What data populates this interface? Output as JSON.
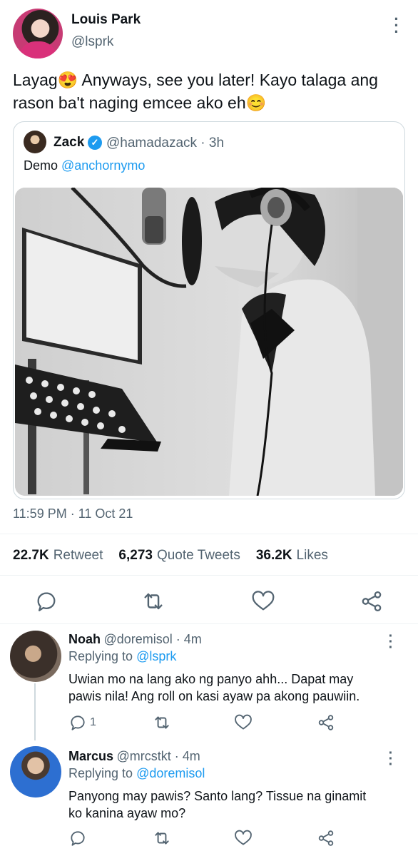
{
  "main_tweet": {
    "author_name": "Louis Park",
    "author_handle": "@lsprk",
    "text_line1": "Layag😍 Anyways, see you later! Kayo talaga ang",
    "text_line2": "rason ba't naging emcee ako eh😊",
    "more_icon": "more-icon"
  },
  "quote": {
    "author_name": "Zack",
    "verified_icon": "verified-badge-icon",
    "handle_time": "@hamadazack · 3h",
    "text_prefix": "Demo ",
    "mention": "@anchornymo",
    "image": "photo-singer-recording-booth"
  },
  "timestamp": "11:59 PM · 11 Oct 21",
  "stats": {
    "retweets_count": "22.7K",
    "retweets_label": "Retweet",
    "quotes_count": "6,273",
    "quotes_label": "Quote Tweets",
    "likes_count": "36.2K",
    "likes_label": "Likes"
  },
  "actions": [
    "reply-icon",
    "retweet-icon",
    "like-icon",
    "share-icon"
  ],
  "replies": [
    {
      "author_name": "Noah",
      "handle_time": "@doremisol · 4m",
      "replying_prefix": "Replying to ",
      "replying_to": "@lsprk",
      "text_line1": "Uwian mo na lang ako ng panyo ahh... Dapat may",
      "text_line2": "pawis nila! Ang roll on kasi ayaw pa akong pauwiin.",
      "reply_count": "1"
    },
    {
      "author_name": "Marcus",
      "handle_time": "@mrcstkt · 4m",
      "replying_prefix": "Replying to ",
      "replying_to": "@doremisol",
      "text_line1": "Panyong may pawis? Santo lang? Tissue na ginamit",
      "text_line2": "ko kanina ayaw mo?",
      "reply_count": ""
    }
  ],
  "colors": {
    "link": "#1d9bf0",
    "secondary_text": "#536471",
    "divider": "#eff3f4"
  }
}
